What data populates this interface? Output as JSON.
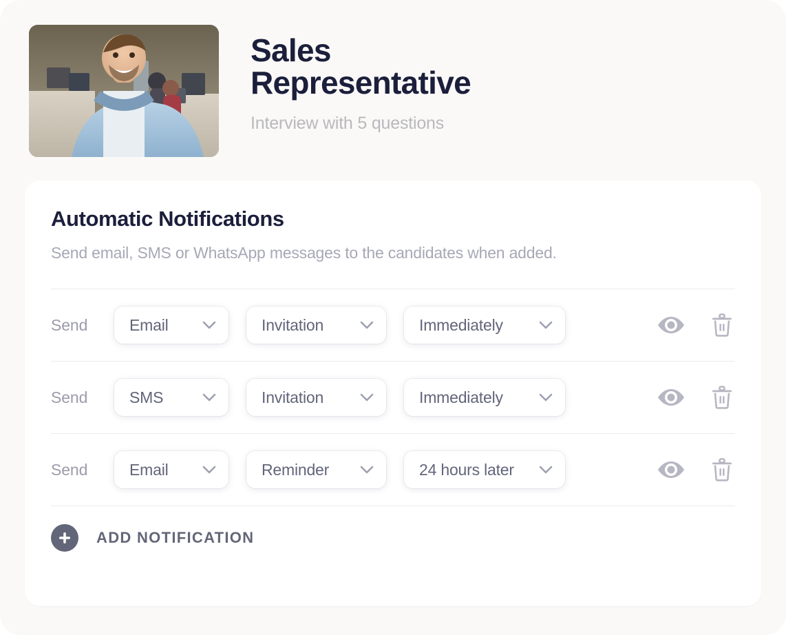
{
  "header": {
    "job_title": "Sales Representative",
    "subtitle": "Interview with 5 questions",
    "thumbnail_alt": "Smiling man in denim shirt in an open plan office"
  },
  "card": {
    "title": "Automatic Notifications",
    "description": "Send email, SMS or WhatsApp messages to the candidates when added.",
    "send_label": "Send",
    "rows": [
      {
        "send_label": "Send",
        "channel": "Email",
        "type": "Invitation",
        "timing": "Immediately",
        "preview_label": "Preview",
        "delete_label": "Delete"
      },
      {
        "send_label": "Send",
        "channel": "SMS",
        "type": "Invitation",
        "timing": "Immediately",
        "preview_label": "Preview",
        "delete_label": "Delete"
      },
      {
        "send_label": "Send",
        "channel": "Email",
        "type": "Reminder",
        "timing": "24 hours later",
        "preview_label": "Preview",
        "delete_label": "Delete"
      }
    ],
    "add_notification_label": "ADD NOTIFICATION"
  },
  "icons": {
    "chevron": "chevron-down-icon",
    "eye": "eye-icon",
    "trash": "trash-icon",
    "plus": "plus-icon"
  },
  "colors": {
    "page_background": "#faf9f7",
    "card_background": "#ffffff",
    "title_text": "#1b1f3b",
    "muted_text": "#a7a8b6",
    "pill_text": "#62657a",
    "icon_gray": "#b6b7c2",
    "accent_slate": "#636678",
    "divider": "#ebebed"
  }
}
